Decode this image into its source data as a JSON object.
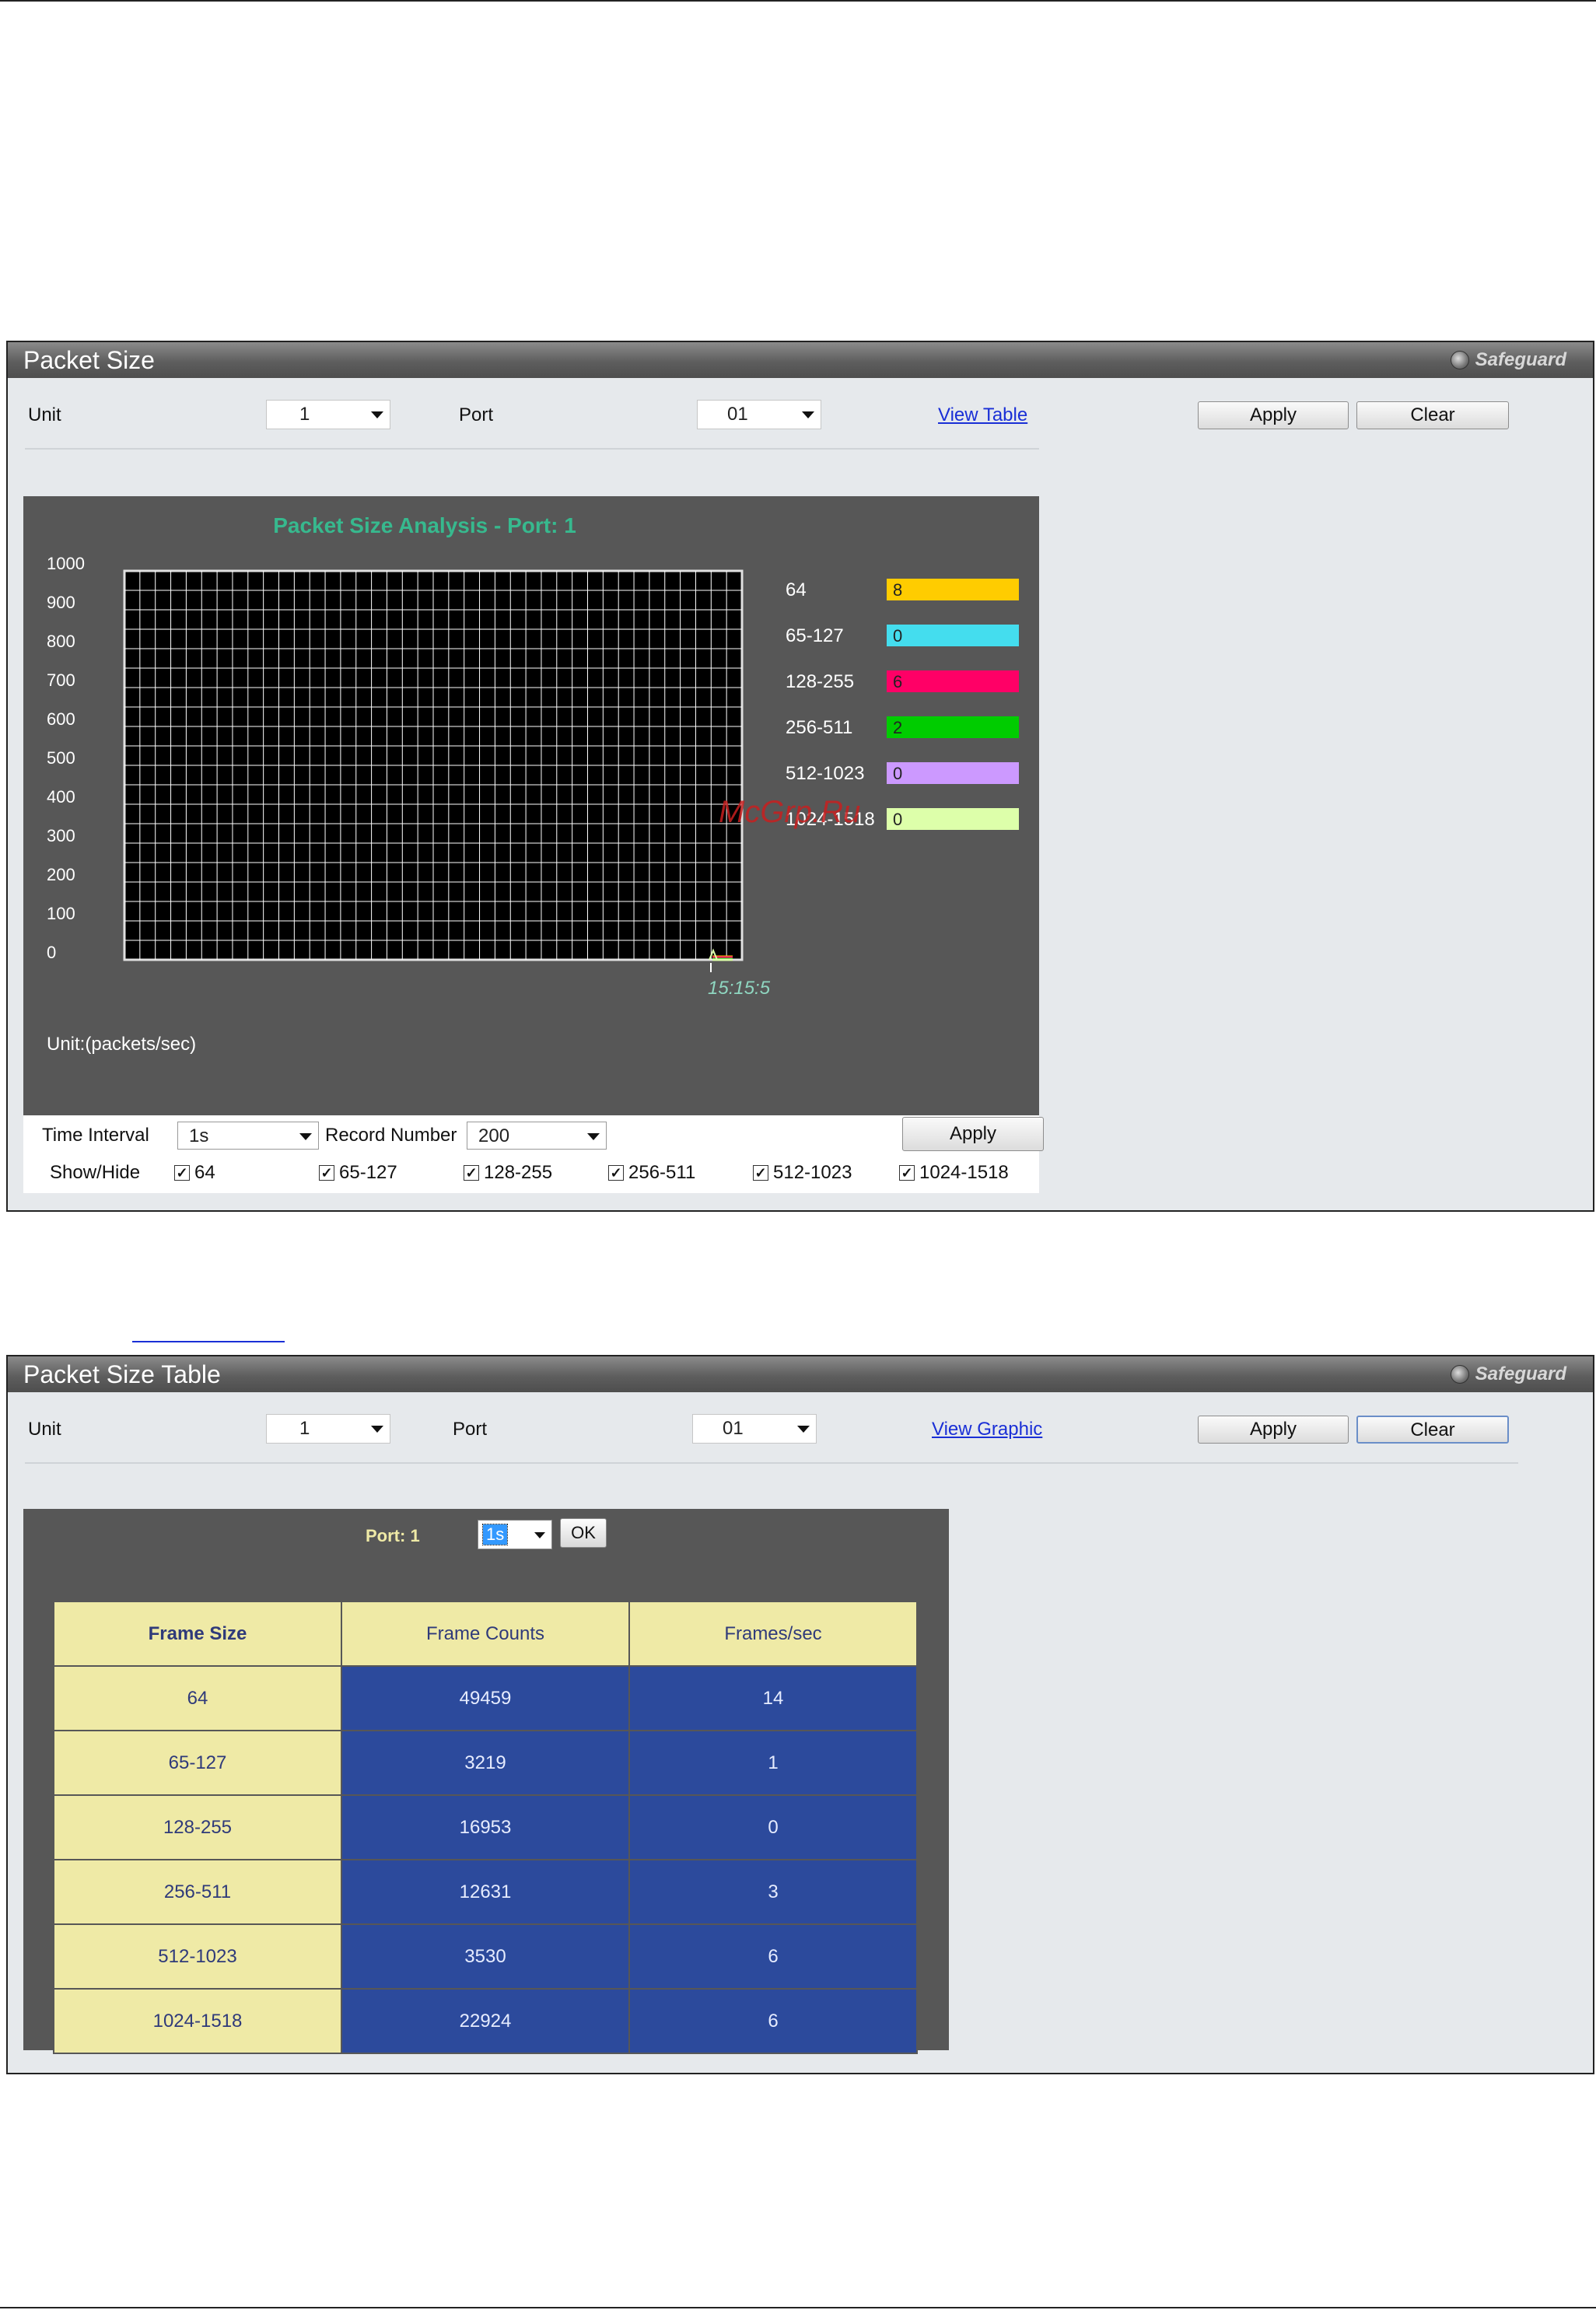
{
  "panel_graph": {
    "title": "Packet Size",
    "safeguard": "Safeguard",
    "unit_label": "Unit",
    "unit_value": "1",
    "port_label": "Port",
    "port_value": "01",
    "view_link": "View Table",
    "apply_label": "Apply",
    "clear_label": "Clear",
    "controls": {
      "time_interval_label": "Time Interval",
      "time_interval_value": "1s",
      "record_number_label": "Record Number",
      "record_number_value": "200",
      "apply_label": "Apply",
      "show_hide_label": "Show/Hide",
      "checkboxes": [
        "64",
        "65-127",
        "128-255",
        "256-511",
        "512-1023",
        "1024-1518"
      ]
    },
    "watermark": "McGrp.Ru"
  },
  "chart_data": {
    "type": "line",
    "title": "Packet Size Analysis - Port: 1",
    "ylabel": "",
    "xlabel": "",
    "unit_text": "Unit:(packets/sec)",
    "y_ticks": [
      1000,
      900,
      800,
      700,
      600,
      500,
      400,
      300,
      200,
      100,
      0
    ],
    "ylim": [
      0,
      1000
    ],
    "x_time_label": "15:15:5",
    "grid": true,
    "legend_position": "right",
    "series": [
      {
        "name": "64",
        "value": 8,
        "color": "#ffcc00"
      },
      {
        "name": "65-127",
        "value": 0,
        "color": "#44ddee"
      },
      {
        "name": "128-255",
        "value": 6,
        "color": "#ff0066"
      },
      {
        "name": "256-511",
        "value": 2,
        "color": "#00cc00"
      },
      {
        "name": "512-1023",
        "value": 0,
        "color": "#cc99ff"
      },
      {
        "name": "1024-1518",
        "value": 0,
        "color": "#ddffaa"
      }
    ]
  },
  "panel_table": {
    "title": "Packet Size Table",
    "safeguard": "Safeguard",
    "unit_label": "Unit",
    "unit_value": "1",
    "port_label": "Port",
    "port_value": "01",
    "view_link": "View Graphic",
    "apply_label": "Apply",
    "clear_label": "Clear",
    "port_caption": "Port: 1",
    "interval_value": "1s",
    "ok_label": "OK",
    "columns": [
      "Frame Size",
      "Frame Counts",
      "Frames/sec"
    ],
    "rows": [
      [
        "64",
        "49459",
        "14"
      ],
      [
        "65-127",
        "3219",
        "1"
      ],
      [
        "128-255",
        "16953",
        "0"
      ],
      [
        "256-511",
        "12631",
        "3"
      ],
      [
        "512-1023",
        "3530",
        "6"
      ],
      [
        "1024-1518",
        "22924",
        "6"
      ]
    ]
  }
}
